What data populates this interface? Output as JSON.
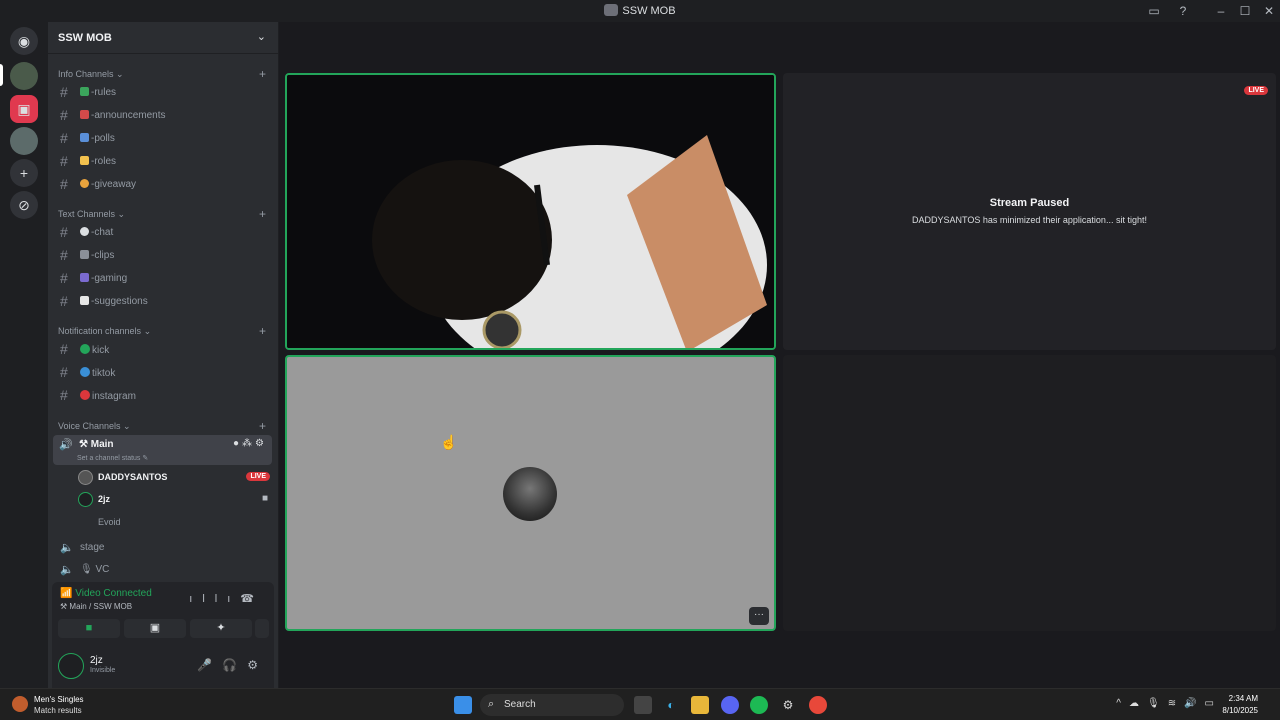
{
  "window": {
    "title": "SSW MOB"
  },
  "server": {
    "name": "SSW MOB",
    "categories": [
      {
        "label": "Info Channels",
        "channels": [
          "-rules",
          "-announcements",
          "-polls",
          "-roles",
          "-giveaway"
        ]
      },
      {
        "label": "Text Channels",
        "channels": [
          "-chat",
          "-clips",
          "-gaming",
          "-suggestions"
        ]
      },
      {
        "label": "Notification channels",
        "channels": [
          "kick",
          "tiktok",
          "instagram"
        ]
      },
      {
        "label": "Voice Channels"
      }
    ],
    "voice": {
      "main": {
        "name": "Main",
        "status": "Set a channel status"
      },
      "users": [
        {
          "name": "DADDYSANTOS",
          "badge": "LIVE"
        },
        {
          "name": "2jz"
        }
      ],
      "sublabel": "Evoid",
      "others": [
        "stage",
        "VC"
      ]
    }
  },
  "voice_panel": {
    "status": "Video Connected",
    "location": "Main / SSW MOB"
  },
  "user": {
    "name": "2jz",
    "status": "Invisible"
  },
  "stage": {
    "stream_title": "Stream Paused",
    "stream_msg": "DADDYSANTOS has minimized their application... sit tight!",
    "live": "LIVE",
    "more": "···"
  },
  "taskbar": {
    "news_title": "Men's Singles",
    "news_sub": "Match results",
    "search": "Search",
    "time": "2:34 AM",
    "date": "8/10/2025"
  },
  "colors": {
    "accent_green": "#23a55a",
    "live_red": "#da373c",
    "sidebar": "#2b2d31"
  }
}
